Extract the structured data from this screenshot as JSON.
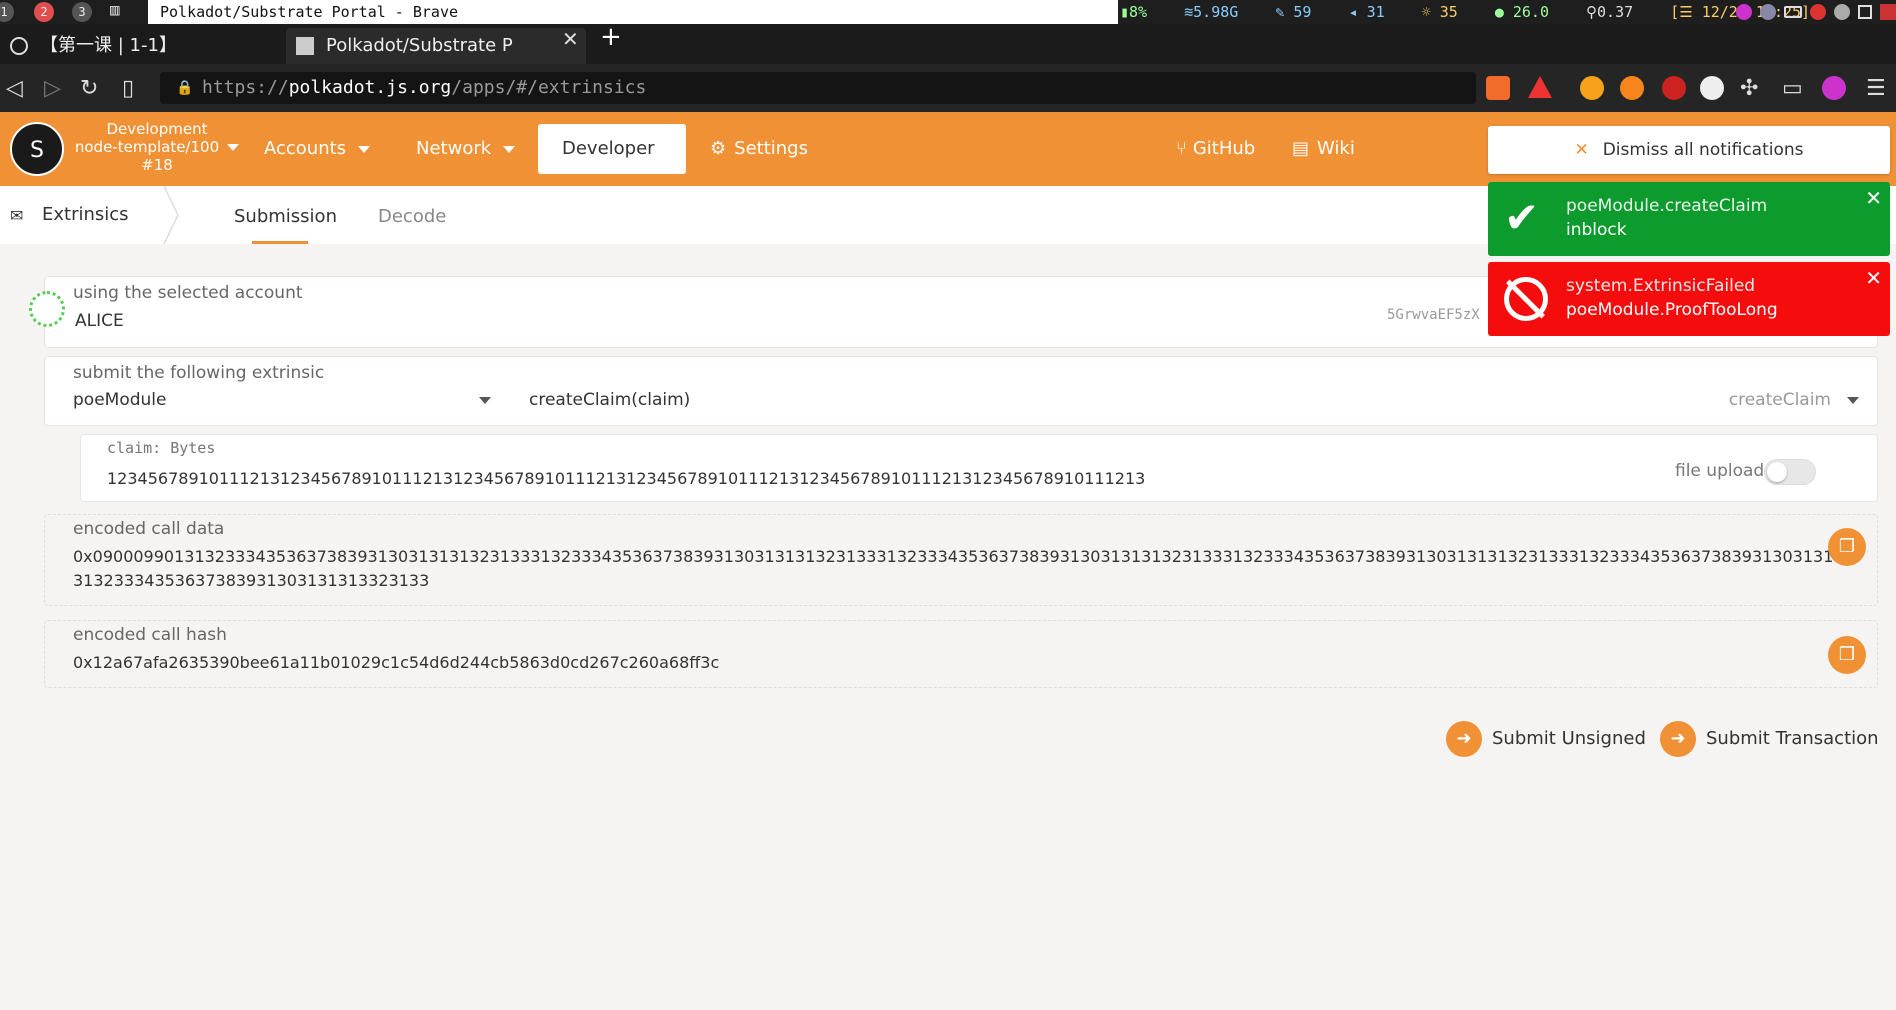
{
  "system": {
    "workspaces": [
      "1",
      "2",
      "3"
    ],
    "window_title": "Polkadot/Substrate Portal - Brave",
    "tray": {
      "battery": "8%",
      "memory": "5.98G",
      "updates": "59",
      "volume": "31",
      "brightness": "35",
      "temp": "26.0",
      "load": "0.37",
      "datetime": "[☰ 12/22 15:25]"
    }
  },
  "browser": {
    "tabs": [
      {
        "label": "【第一课 | 1-1】"
      },
      {
        "label": "Polkadot/Substrate P"
      }
    ],
    "url": {
      "scheme": "https://",
      "host": "polkadot.js.org",
      "path": "/apps/#/extrinsics"
    }
  },
  "app": {
    "chain": {
      "line1": "Development",
      "line2": "node-template/100",
      "line3": "#18"
    },
    "menu": {
      "accounts": "Accounts",
      "network": "Network",
      "developer": "Developer",
      "settings": "Settings",
      "github": "GitHub",
      "wiki": "Wiki"
    },
    "subnav": {
      "title": "Extrinsics",
      "tabs": [
        "Submission",
        "Decode"
      ]
    },
    "account": {
      "label": "using the selected account",
      "name": "ALICE",
      "address": "5GrwvaEF5zX"
    },
    "extrinsic": {
      "label": "submit the following extrinsic",
      "module": "poeModule",
      "call": "createClaim(claim)",
      "method": "createClaim"
    },
    "claim": {
      "label": "claim: Bytes",
      "value": "123456789101112131234567891011121312345678910111213123456789101112131234567891011121312345678910111213",
      "file_upload": "file upload"
    },
    "encoded_call_data": {
      "label": "encoded call data",
      "line1": "0x09000990131323334353637383931303131313231333132333435363738393130313131323133313233343536373839313031313132313331323334353637383931303131313231333132333435363738393130313131323133",
      "line2": "31323334353637383931303131313323133"
    },
    "encoded_call_hash": {
      "label": "encoded call hash",
      "value": "0x12a67afa2635390bee61a11b01029c1c54d6d244cb5863d0cd267c260a68ff3c"
    },
    "buttons": {
      "submit_unsigned": "Submit Unsigned",
      "submit_transaction": "Submit Transaction"
    }
  },
  "notifications": {
    "dismiss": "Dismiss all notifications",
    "items": [
      {
        "title": "poeModule.createClaim",
        "status": "inblock",
        "color": "#0d9b2e"
      },
      {
        "title": "system.ExtrinsicFailed",
        "status": "poeModule.ProofTooLong",
        "color": "#f50d0d"
      }
    ]
  }
}
